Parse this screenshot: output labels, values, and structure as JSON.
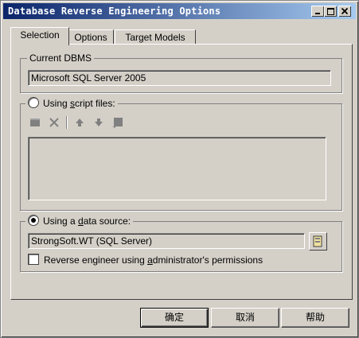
{
  "window": {
    "title": "Database Reverse Engineering Options"
  },
  "tabs": [
    {
      "label": "Selection",
      "active": true
    },
    {
      "label": "Options",
      "active": false
    },
    {
      "label": "Target Models",
      "active": false
    }
  ],
  "current_dbms": {
    "legend": "Current DBMS",
    "value": "Microsoft SQL Server 2005"
  },
  "script_files": {
    "label_pre": "Using ",
    "label_accel": "s",
    "label_post": "cript files:",
    "selected": false,
    "toolbar": [
      "add-file-icon",
      "delete-icon",
      "move-up-icon",
      "move-down-icon",
      "browse-icon"
    ]
  },
  "data_source": {
    "label_pre": "Using a ",
    "label_accel": "d",
    "label_post": "ata source:",
    "selected": true,
    "value": "StrongSoft.WT (SQL Server)",
    "admin_label_pre": "Reverse engineer using ",
    "admin_label_accel": "a",
    "admin_label_post": "dministrator's permissions",
    "admin_checked": false
  },
  "buttons": {
    "ok": "确定",
    "cancel": "取消",
    "help": "帮助"
  },
  "colors": {
    "titlebar_start": "#0a246a",
    "titlebar_end": "#a6caf0",
    "face": "#d4d0c8"
  }
}
